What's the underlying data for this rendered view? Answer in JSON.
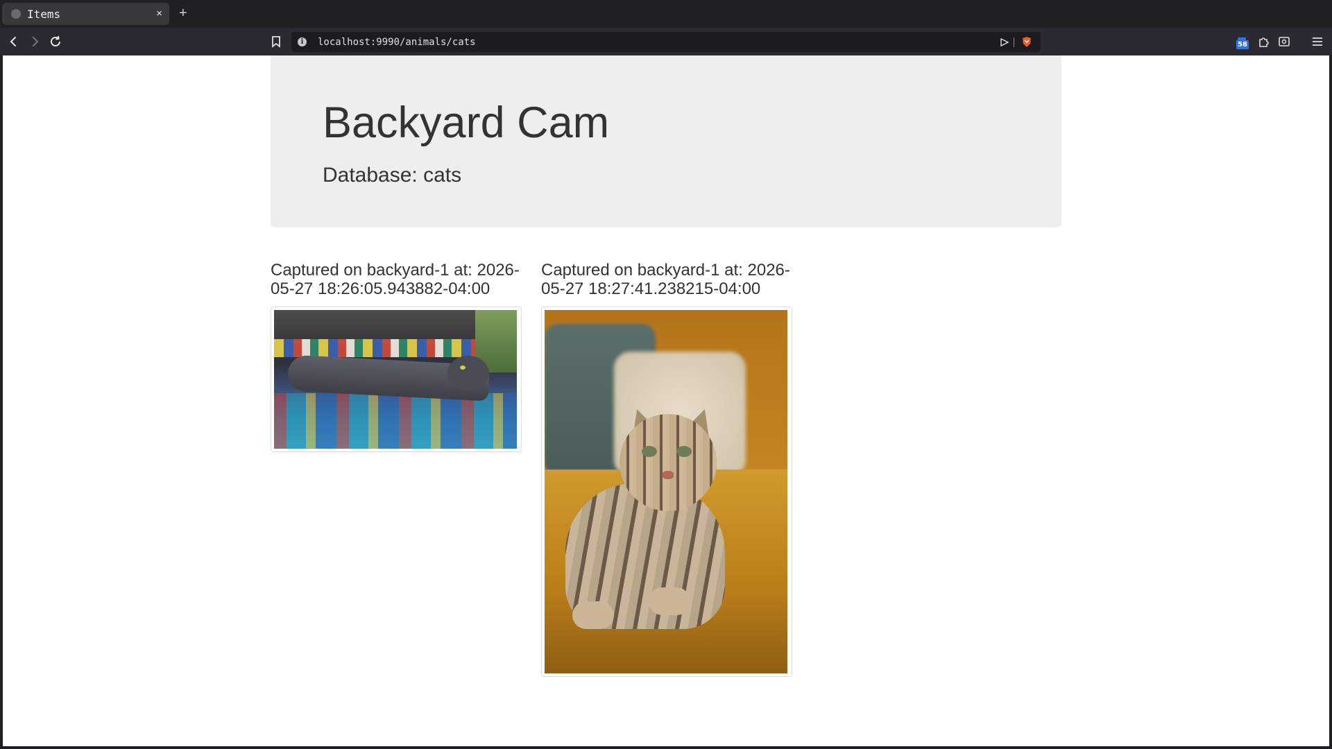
{
  "browser": {
    "tab_title": "Items",
    "tab_close": "×",
    "new_tab": "+",
    "url": "localhost:9990/animals/cats",
    "extension_badge": "58"
  },
  "page": {
    "title": "Backyard Cam",
    "subtitle": "Database: cats",
    "captures": [
      {
        "caption": "Captured on backyard-1 at: 2026-05-27 18:26:05.943882-04:00"
      },
      {
        "caption": "Captured on backyard-1 at: 2026-05-27 18:27:41.238215-04:00"
      }
    ]
  }
}
